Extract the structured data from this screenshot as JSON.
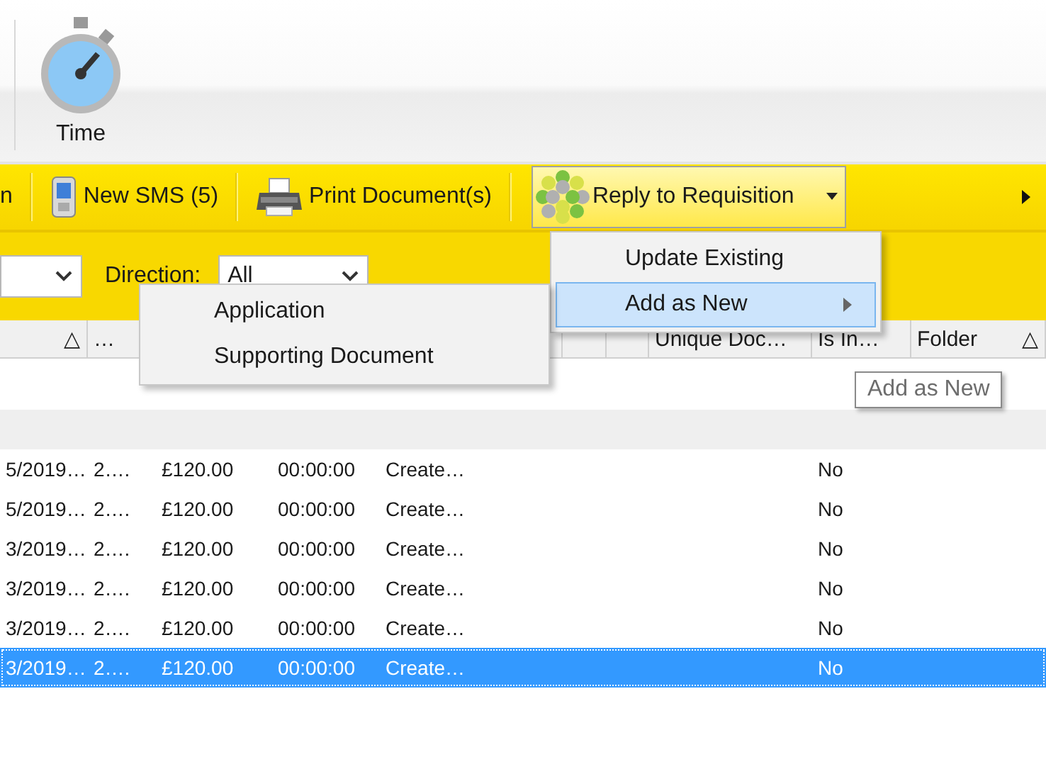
{
  "ribbon": {
    "buttons": [
      {
        "label": "Time"
      }
    ]
  },
  "toolbar": {
    "items": [
      {
        "kind": "text",
        "label": "n"
      },
      {
        "kind": "sms",
        "label": "New SMS (5)"
      },
      {
        "kind": "print",
        "label": "Print Document(s)"
      },
      {
        "kind": "reply",
        "label": "Reply to Requisition",
        "open": true
      }
    ]
  },
  "filters": {
    "direction": {
      "label": "Direction:",
      "value": "All"
    }
  },
  "table": {
    "columns": [
      {
        "sort": "△"
      },
      {
        "label": "…"
      },
      {},
      {},
      {},
      {},
      {},
      {
        "label": "Unique Doc…"
      },
      {
        "label": "Is In…"
      },
      {
        "label": "Folder",
        "sort": "△"
      }
    ],
    "rows": [
      {
        "cells": [
          "5/2019…",
          "2….",
          "£120.00",
          "00:00:00",
          "Create…"
        ],
        "is_in": "No",
        "selected": false
      },
      {
        "cells": [
          "5/2019…",
          "2….",
          "£120.00",
          "00:00:00",
          "Create…"
        ],
        "is_in": "No",
        "selected": false
      },
      {
        "cells": [
          "3/2019…",
          "2….",
          "£120.00",
          "00:00:00",
          "Create…"
        ],
        "is_in": "No",
        "selected": false
      },
      {
        "cells": [
          "3/2019…",
          "2….",
          "£120.00",
          "00:00:00",
          "Create…"
        ],
        "is_in": "No",
        "selected": false
      },
      {
        "cells": [
          "3/2019…",
          "2….",
          "£120.00",
          "00:00:00",
          "Create…"
        ],
        "is_in": "No",
        "selected": false
      },
      {
        "cells": [
          "3/2019…",
          "2….",
          "£120.00",
          "00:00:00",
          "Create…"
        ],
        "is_in": "No",
        "selected": true
      }
    ]
  },
  "reply_menu": {
    "items": [
      {
        "label": "Update Existing",
        "selected": false,
        "submenu": false
      },
      {
        "label": "Add as New",
        "selected": true,
        "submenu": true
      }
    ]
  },
  "submenu": {
    "items": [
      {
        "label": "Application"
      },
      {
        "label": "Supporting Document"
      }
    ]
  },
  "tooltip": {
    "text": "Add as New"
  }
}
